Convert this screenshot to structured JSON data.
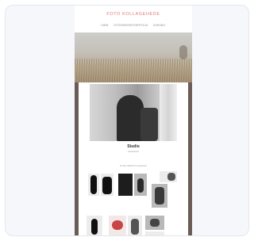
{
  "site": {
    "logo": "FOTO KOLLAGEHEDE",
    "nav": [
      "HJEM",
      "FOTOGRAFER-PORTFOLIO",
      "KONTAKT"
    ]
  },
  "gallery": {
    "title": "Studio",
    "subtitle": "Fotosession",
    "caption": "Se flere billeder fra sessionen"
  },
  "colors": {
    "accent": "#e07b7b",
    "frame": "#6b5d55"
  }
}
